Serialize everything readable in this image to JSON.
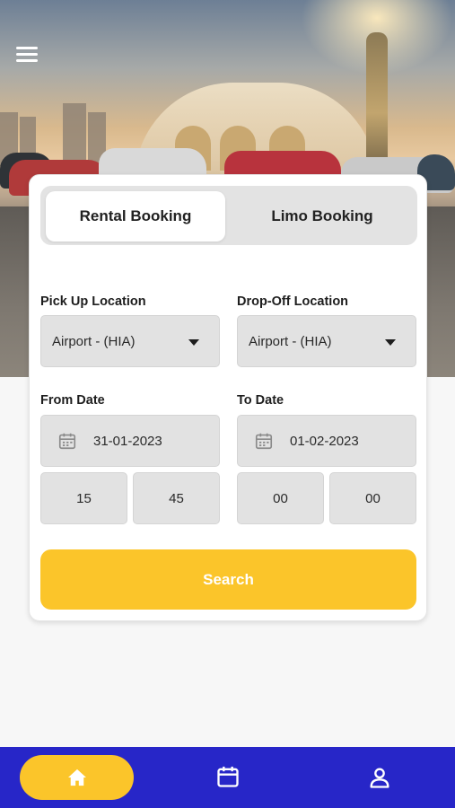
{
  "header": {
    "menu_icon": "hamburger-menu-icon"
  },
  "booking_tabs": {
    "active": "Rental Booking",
    "items": [
      {
        "label": "Rental Booking"
      },
      {
        "label": "Limo Booking"
      }
    ]
  },
  "form": {
    "pickup": {
      "label": "Pick Up Location",
      "value": "Airport - (HIA)"
    },
    "dropoff": {
      "label": "Drop-Off Location",
      "value": "Airport - (HIA)"
    },
    "from": {
      "label": "From Date",
      "date": "31-01-2023",
      "hour": "15",
      "minute": "45"
    },
    "to": {
      "label": "To Date",
      "date": "01-02-2023",
      "hour": "00",
      "minute": "00"
    },
    "search_label": "Search"
  },
  "bottom_nav": {
    "active": "home",
    "items": [
      {
        "name": "home",
        "icon": "home-icon"
      },
      {
        "name": "bookings",
        "icon": "calendar-icon"
      },
      {
        "name": "profile",
        "icon": "user-icon"
      }
    ]
  },
  "colors": {
    "accent": "#fbc52a",
    "nav": "#2726c8",
    "field": "#e2e2e2"
  }
}
